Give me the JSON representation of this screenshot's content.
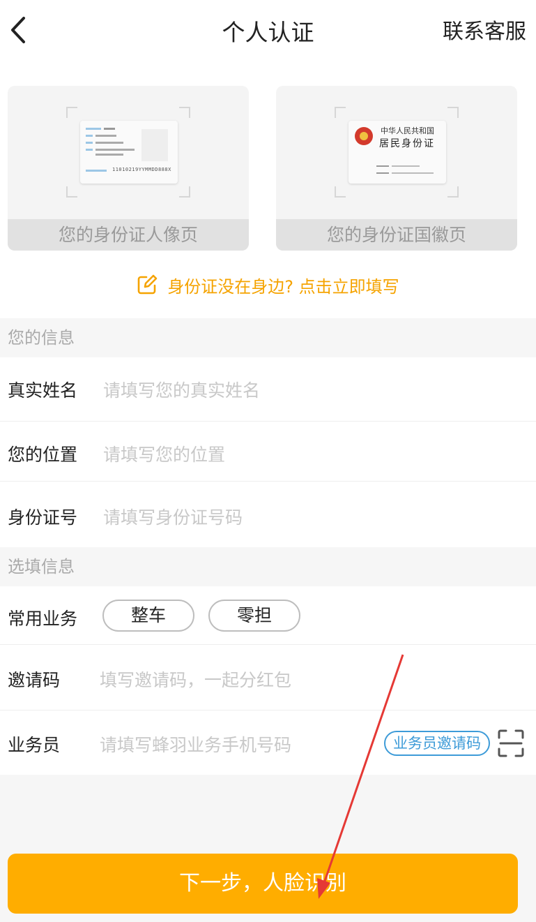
{
  "header": {
    "title": "个人认证",
    "contact": "联系客服"
  },
  "id_cards": {
    "front_caption": "您的身份证人像页",
    "back_caption": "您的身份证国徽页",
    "back_title_line1": "中华人民共和国",
    "back_title_line2": "居民身份证",
    "front_number": "11010219YYMMDD888X"
  },
  "manual_link": "身份证没在身边? 点击立即填写",
  "section_info": {
    "title": "您的信息",
    "name_label": "真实姓名",
    "name_placeholder": "请填写您的真实姓名",
    "location_label": "您的位置",
    "location_placeholder": "请填写您的位置",
    "idno_label": "身份证号",
    "idno_placeholder": "请填写身份证号码"
  },
  "section_optional": {
    "title": "选填信息",
    "business_label": "常用业务",
    "business_options": [
      "整车",
      "零担"
    ],
    "invite_label": "邀请码",
    "invite_placeholder": "填写邀请码，一起分红包",
    "agent_label": "业务员",
    "agent_placeholder": "请填写蜂羽业务手机号码",
    "agent_badge": "业务员邀请码"
  },
  "next_button": "下一步，人脸识别",
  "colors": {
    "accent": "#ffad00",
    "link": "#f5a300",
    "badge": "#3d9bd8",
    "annotation": "#e53935"
  }
}
